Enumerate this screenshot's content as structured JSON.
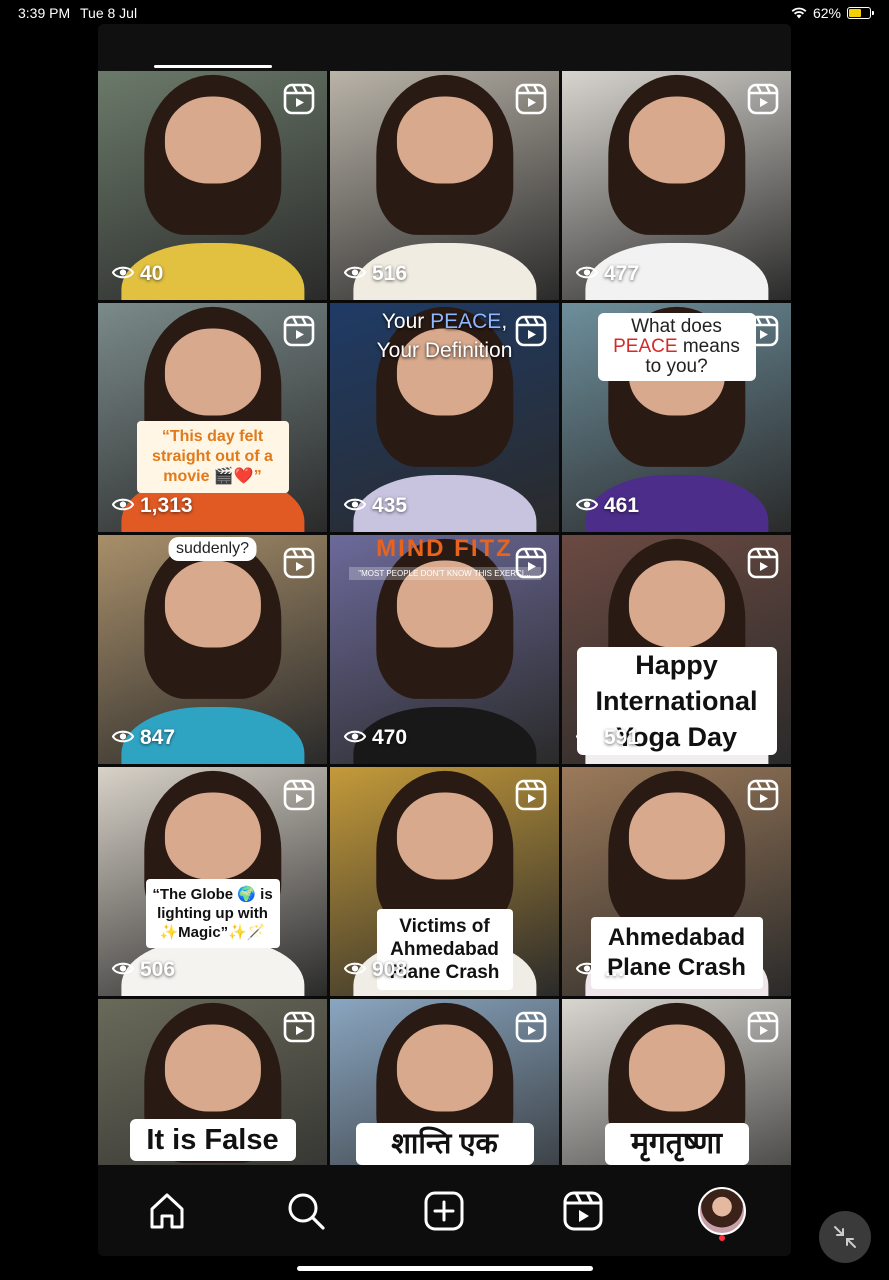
{
  "status_bar": {
    "time": "3:39 PM",
    "date": "Tue 8 Jul",
    "battery": "62%",
    "battery_level": 0.62
  },
  "reels": [
    {
      "views": "40",
      "bg": "#6b7a6a",
      "body": "#e2c040"
    },
    {
      "views": "516",
      "bg": "#b9b3a8",
      "body": "#f1ece2"
    },
    {
      "views": "477",
      "bg": "#d8d5cf",
      "body": "#f2f2f2"
    },
    {
      "views": "1,313",
      "bg": "#7b8a8a",
      "body": "#e15a24",
      "caption": "“This day felt straight out of a movie 🎬❤️”"
    },
    {
      "views": "435",
      "bg": "#1f3b66",
      "body": "#c8c4e0",
      "caption": "Your PEACE, Your Definition",
      "caption_lines": [
        "Your ",
        "PEACE",
        ",",
        "Your Definition"
      ]
    },
    {
      "views": "461",
      "bg": "#6d8f9c",
      "body": "#4c2d8a",
      "caption": "What does PEACE means to you?",
      "caption_lines": [
        "What does",
        "PEACE",
        " means",
        "to you?"
      ]
    },
    {
      "views": "847",
      "bg": "#a88f6a",
      "body": "#2fa4c2",
      "caption": "suddenly?"
    },
    {
      "views": "470",
      "bg": "#6c6a9a",
      "body": "#181818",
      "caption": "MIND FITZ",
      "subcaption": "\"MOST PEOPLE DON'T KNOW THIS EXERCI..."
    },
    {
      "views": "591",
      "bg": "#6b4a42",
      "body": "#f0eeee",
      "caption": "Happy International Yoga Day"
    },
    {
      "views": "506",
      "bg": "#d8d2c8",
      "body": "#f5f3f0",
      "caption": "“The Globe 🌍 is lighting up with ✨Magic”✨🪄"
    },
    {
      "views": "908",
      "bg": "#c49a3a",
      "body": "#f0ece6",
      "caption": "Victims of Ahmedabad Plane Crash"
    },
    {
      "views": "…",
      "bg": "#9c7a5a",
      "body": "#efe6ec",
      "caption": "Ahmedabad Plane Crash"
    },
    {
      "views": "",
      "bg": "#6a6a5a",
      "body": "#f2f2f2",
      "caption": "It is False"
    },
    {
      "views": "",
      "bg": "#8aa6c0",
      "body": "#f0f0f0",
      "caption": "शान्ति एक"
    },
    {
      "views": "",
      "bg": "#d9d6d0",
      "body": "#e8e4dc",
      "caption": "मृगतृष्णा"
    }
  ],
  "nav": {
    "home": "home-icon",
    "search": "search-icon",
    "create": "create-icon",
    "reels": "reels-icon",
    "profile": "profile-avatar"
  }
}
